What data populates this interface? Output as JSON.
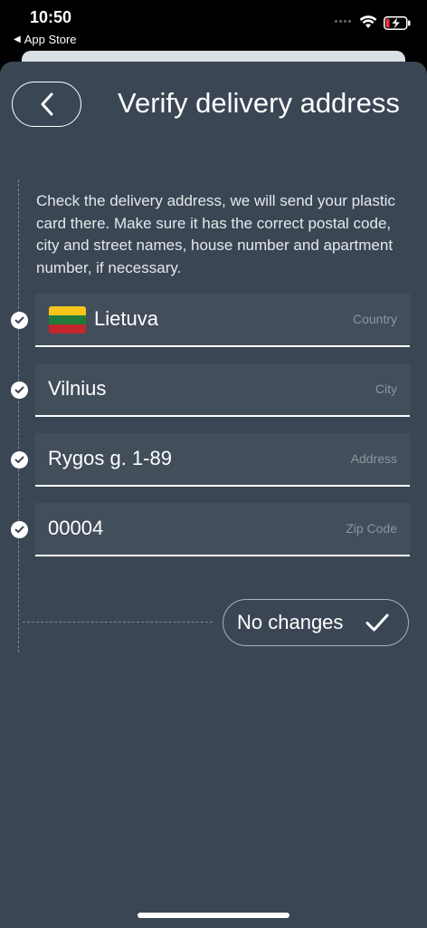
{
  "status_bar": {
    "time": "10:50",
    "back_app": "App Store"
  },
  "header": {
    "title": "Verify delivery address"
  },
  "intro": "Check the delivery address, we will send your plastic card there. Make sure it has the correct postal code, city and street names, house number and apartment number, if necessary.",
  "fields": [
    {
      "value": "Lietuva",
      "label": "Country",
      "flag_colors": [
        "#f7c41a",
        "#217a3b",
        "#c1272d"
      ]
    },
    {
      "value": "Vilnius",
      "label": "City"
    },
    {
      "value": "Rygos g. 1-89",
      "label": "Address"
    },
    {
      "value": "00004",
      "label": "Zip Code"
    }
  ],
  "actions": {
    "no_changes_label": "No changes"
  },
  "colors": {
    "background": "#3b4654",
    "field_background": "#434e5b",
    "text": "#ffffff",
    "muted_label": "#8b95a0",
    "battery_low": "#e5373a"
  },
  "icons": {
    "back": "chevron-left-icon",
    "check": "checkmark-icon",
    "wifi": "wifi-icon",
    "battery": "battery-charging-icon"
  }
}
